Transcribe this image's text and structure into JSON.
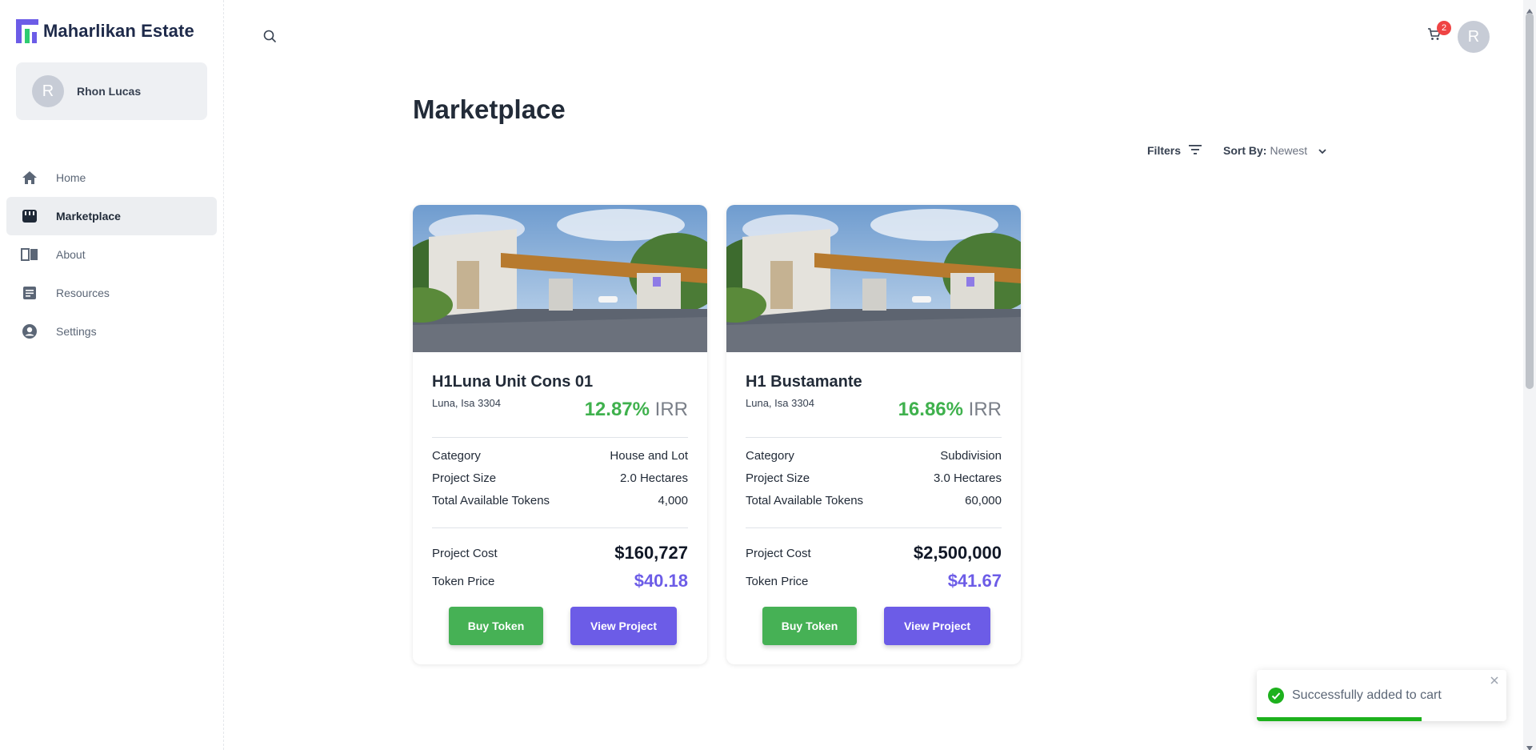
{
  "app": {
    "name": "Maharlikan Estate",
    "brand_colors": {
      "primary": "#6c5ce7",
      "green": "#46b155",
      "accent_green": "#2ecc71"
    }
  },
  "user": {
    "name": "Rhon Lucas",
    "initial": "R"
  },
  "sidebar": {
    "items": [
      {
        "label": "Home",
        "icon": "home-icon",
        "active": false
      },
      {
        "label": "Marketplace",
        "icon": "store-icon",
        "active": true
      },
      {
        "label": "About",
        "icon": "book-icon",
        "active": false
      },
      {
        "label": "Resources",
        "icon": "document-icon",
        "active": false
      },
      {
        "label": "Settings",
        "icon": "account-circle-icon",
        "active": false
      }
    ]
  },
  "header": {
    "search_icon": "search-icon",
    "cart_icon": "cart-icon",
    "cart_count": "2",
    "avatar_initial": "R"
  },
  "main": {
    "title": "Marketplace",
    "filters_label": "Filters",
    "sort_label": "Sort By:",
    "sort_value": "Newest"
  },
  "cards": [
    {
      "title": "H1Luna Unit Cons 01",
      "location": "Luna, Isa 3304",
      "irr_value": "12.87%",
      "irr_label": "IRR",
      "category_label": "Category",
      "category_value": "House and Lot",
      "size_label": "Project Size",
      "size_value": "2.0 Hectares",
      "tokens_label": "Total Available Tokens",
      "tokens_value": "4,000",
      "cost_label": "Project Cost",
      "cost_value": "$160,727",
      "price_label": "Token Price",
      "price_value": "$40.18",
      "buy_label": "Buy Token",
      "view_label": "View Project"
    },
    {
      "title": "H1 Bustamante",
      "location": "Luna, Isa 3304",
      "irr_value": "16.86%",
      "irr_label": "IRR",
      "category_label": "Category",
      "category_value": "Subdivision",
      "size_label": "Project Size",
      "size_value": "3.0 Hectares",
      "tokens_label": "Total Available Tokens",
      "tokens_value": "60,000",
      "cost_label": "Project Cost",
      "cost_value": "$2,500,000",
      "price_label": "Token Price",
      "price_value": "$41.67",
      "buy_label": "Buy Token",
      "view_label": "View Project"
    }
  ],
  "toast": {
    "message": "Successfully added to cart",
    "status_color": "#1db11d",
    "progress": 0.66
  }
}
